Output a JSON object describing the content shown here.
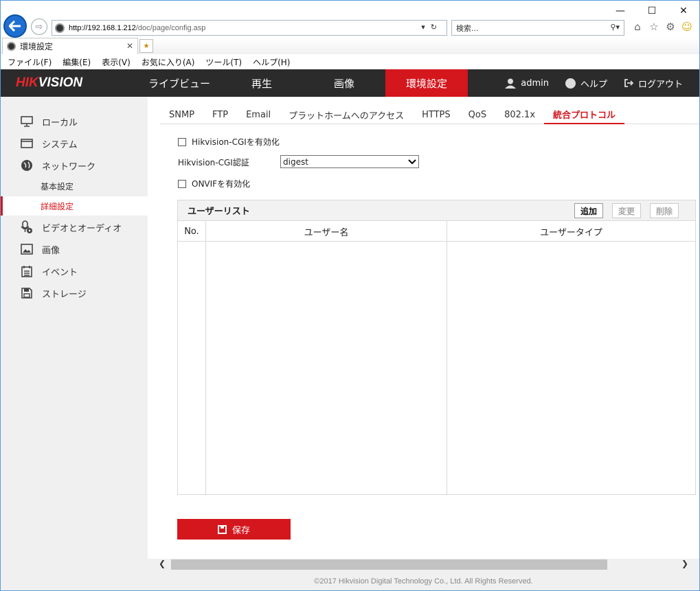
{
  "browser": {
    "url_host": "http://192.168.1.212",
    "url_path": "/doc/page/config.asp",
    "search_placeholder": "検索...",
    "tab_title": "環境設定",
    "menu": [
      "ファイル(F)",
      "編集(E)",
      "表示(V)",
      "お気に入り(A)",
      "ツール(T)",
      "ヘルプ(H)"
    ]
  },
  "app": {
    "logo_hik": "HIK",
    "logo_vision": "VISION",
    "nav": [
      "ライブビュー",
      "再生",
      "画像",
      "環境設定"
    ],
    "active_nav": "環境設定",
    "user": "admin",
    "help": "ヘルプ",
    "logout": "ログアウト",
    "accent_color": "#d4161d"
  },
  "sidebar": {
    "items": [
      {
        "label": "ローカル",
        "icon": "monitor-icon"
      },
      {
        "label": "システム",
        "icon": "window-icon"
      },
      {
        "label": "ネットワーク",
        "icon": "globe-icon"
      },
      {
        "label": "ビデオとオーディオ",
        "icon": "microphone-icon"
      },
      {
        "label": "画像",
        "icon": "image-icon"
      },
      {
        "label": "イベント",
        "icon": "calendar-icon"
      },
      {
        "label": "ストレージ",
        "icon": "floppy-icon"
      }
    ],
    "sub": [
      "基本設定",
      "詳細設定"
    ],
    "active_sub": "詳細設定"
  },
  "subtabs": [
    "SNMP",
    "FTP",
    "Email",
    "プラットホームへのアクセス",
    "HTTPS",
    "QoS",
    "802.1x",
    "統合プロトコル"
  ],
  "active_subtab": "統合プロトコル",
  "form": {
    "cgi_enable_label": "Hikvision-CGIを有効化",
    "cgi_enable_checked": false,
    "cgi_auth_label": "Hikvision-CGI認証",
    "cgi_auth_value": "digest",
    "onvif_enable_label": "ONVIFを有効化",
    "onvif_enable_checked": false
  },
  "userlist": {
    "title": "ユーザーリスト",
    "add": "追加",
    "edit": "変更",
    "delete": "削除",
    "columns": [
      "No.",
      "ユーザー名",
      "ユーザータイプ"
    ],
    "rows": []
  },
  "save_label": "保存",
  "footer": "©2017 Hikvision Digital Technology Co., Ltd. All Rights Reserved."
}
